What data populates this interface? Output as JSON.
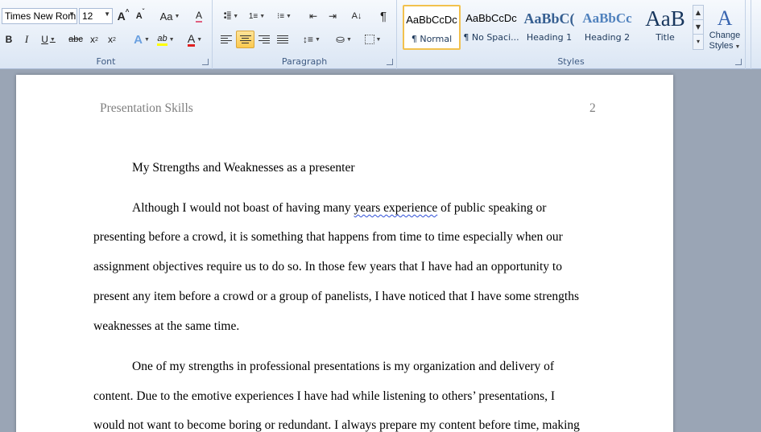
{
  "font_group": {
    "label": "Font",
    "font_name": "Times New Rom",
    "font_size": "12",
    "grow_font": "A",
    "shrink_font": "A",
    "change_case": "Aa",
    "clear_format": "A",
    "bold": "B",
    "italic": "I",
    "underline": "U",
    "strikethrough": "abc",
    "subscript": "x",
    "superscript": "x",
    "text_effects": "A",
    "highlight": "ab",
    "font_color": "A",
    "highlight_color": "#ffff00",
    "font_color_value": "#e02020"
  },
  "paragraph_group": {
    "label": "Paragraph",
    "show_marks": "¶"
  },
  "styles_group": {
    "label": "Styles",
    "styles": [
      {
        "preview": "AaBbCcDc",
        "name": "¶ Normal",
        "selected": true
      },
      {
        "preview": "AaBbCcDc",
        "name": "¶ No Spaci...",
        "selected": false
      },
      {
        "preview": "AaBbC(",
        "name": "Heading 1",
        "selected": false
      },
      {
        "preview": "AaBbCc",
        "name": "Heading 2",
        "selected": false
      },
      {
        "preview": "AaB",
        "name": "Title",
        "selected": false
      }
    ],
    "change_styles_line1": "Change",
    "change_styles_line2": "Styles",
    "change_styles_icon": "A"
  },
  "document": {
    "header_left": "Presentation Skills",
    "header_page": "2",
    "title_line": "My Strengths and Weaknesses as a presenter",
    "p1": {
      "l1_a": "Although I would not boast of having many ",
      "l1_b": "years experience",
      "l1_c": " of public speaking or",
      "l2": "presenting before a crowd, it is something that happens from time to time especially when our",
      "l3": "assignment objectives require us to do so. In those few years that I have had an opportunity to",
      "l4": "present any item before a crowd or a group of panelists, I have noticed that I have some strengths",
      "l5": "weaknesses at the same time."
    },
    "p2": {
      "l1": "One of my strengths in professional presentations is my organization and delivery of",
      "l2": "content. Due to the emotive experiences I have had while listening to others’ presentations, I",
      "l3": "would not want to become boring or redundant. I always prepare my content before time, making"
    }
  }
}
